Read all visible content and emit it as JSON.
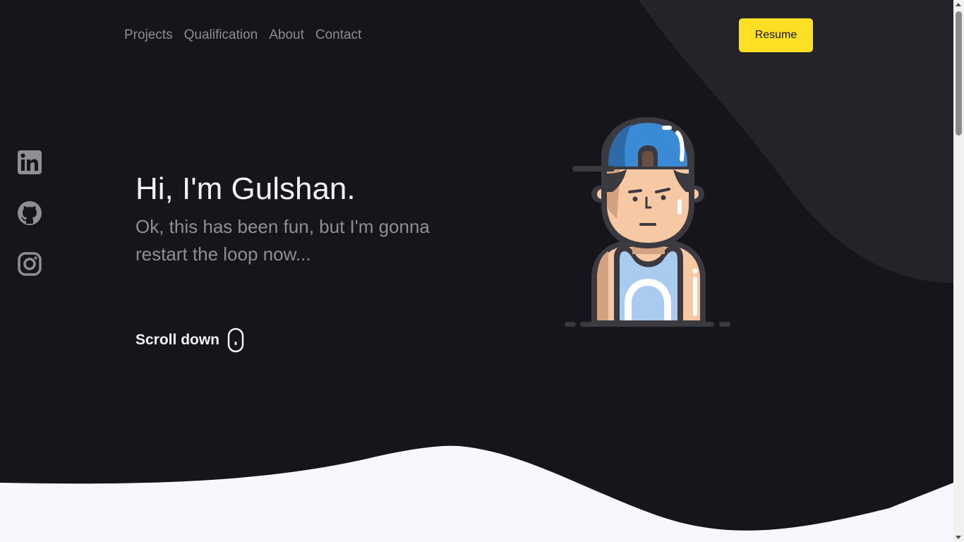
{
  "nav": {
    "links": [
      {
        "label": "Projects"
      },
      {
        "label": "Qualification"
      },
      {
        "label": "About"
      },
      {
        "label": "Contact"
      }
    ],
    "resume_label": "Resume"
  },
  "socials": [
    {
      "icon": "linkedin-icon"
    },
    {
      "icon": "github-icon"
    },
    {
      "icon": "instagram-icon"
    }
  ],
  "hero": {
    "title": "Hi, I'm Gulshan.",
    "subtitle": "Ok, this has been fun, but I'm gonna restart the loop now...",
    "scroll_label": "Scroll down",
    "scroll_icon": "mouse-icon",
    "avatar_icon": "avatar-illustration"
  },
  "colors": {
    "background": "#16151b",
    "accent": "#fddf24",
    "blob": "#242329",
    "wave": "#f8f7fe",
    "muted_text": "#8f8e94"
  }
}
